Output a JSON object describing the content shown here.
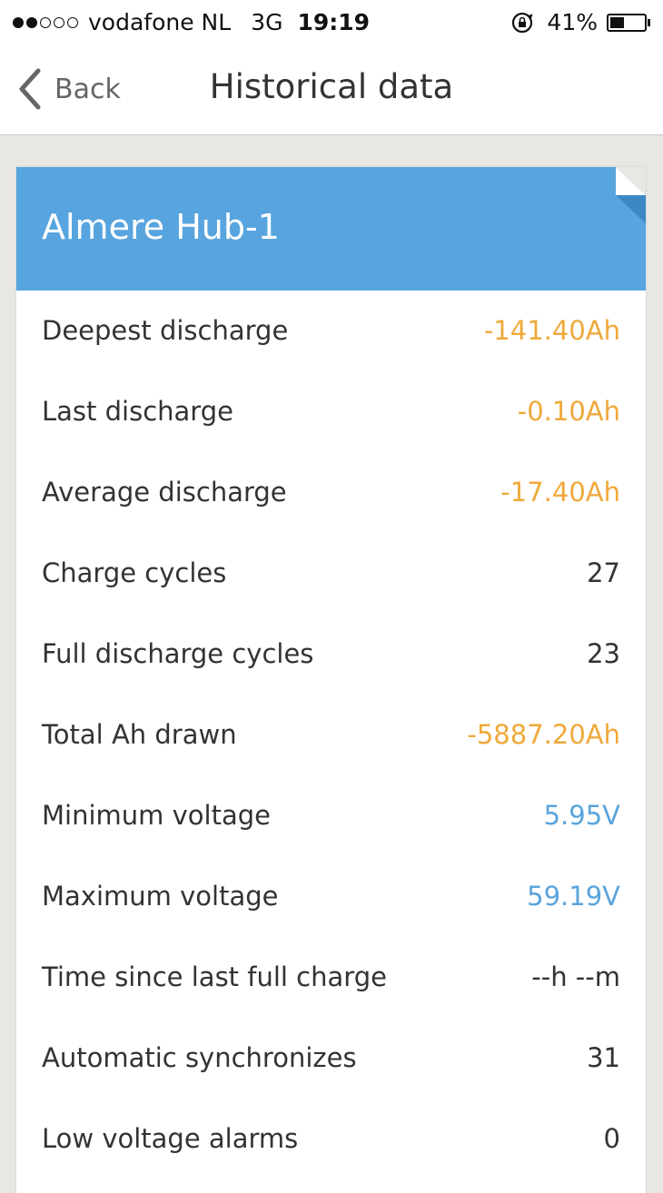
{
  "status_bar": {
    "carrier": "vodafone NL",
    "network": "3G",
    "time": "19:19",
    "battery_percent": "41%",
    "battery_level": 0.41,
    "signal_bars_filled": 2,
    "signal_bars_total": 5
  },
  "nav": {
    "back_label": "Back",
    "title": "Historical data"
  },
  "card": {
    "title": "Almere Hub-1",
    "header_color": "#57a4df"
  },
  "colors": {
    "warning_value": "#efa93a",
    "info_value": "#5aa4dc"
  },
  "rows": [
    {
      "label": "Deepest discharge",
      "value": "-141.40Ah",
      "tone": "orange"
    },
    {
      "label": "Last discharge",
      "value": "-0.10Ah",
      "tone": "orange"
    },
    {
      "label": "Average discharge",
      "value": "-17.40Ah",
      "tone": "orange"
    },
    {
      "label": "Charge cycles",
      "value": "27",
      "tone": "default"
    },
    {
      "label": "Full discharge cycles",
      "value": "23",
      "tone": "default"
    },
    {
      "label": "Total Ah drawn",
      "value": "-5887.20Ah",
      "tone": "orange"
    },
    {
      "label": "Minimum voltage",
      "value": "5.95V",
      "tone": "blue"
    },
    {
      "label": "Maximum voltage",
      "value": "59.19V",
      "tone": "blue"
    },
    {
      "label": "Time since last full charge",
      "value": "--h --m",
      "tone": "default"
    },
    {
      "label": "Automatic synchronizes",
      "value": "31",
      "tone": "default"
    },
    {
      "label": "Low voltage alarms",
      "value": "0",
      "tone": "default"
    }
  ]
}
